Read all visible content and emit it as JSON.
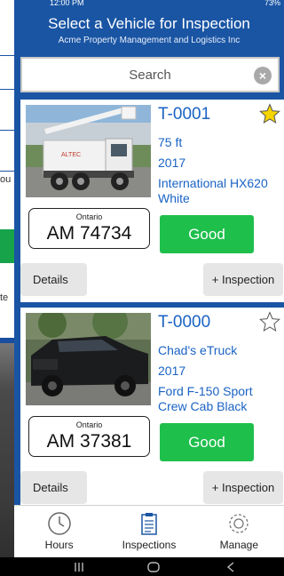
{
  "status_bar": {
    "time": "12:00 PM",
    "battery": "73%"
  },
  "background": {
    "snippet_1": "ou",
    "snippet_2": "te"
  },
  "header": {
    "title": "Select a Vehicle for Inspection",
    "subtitle": "Acme Property Management and Logistics Inc"
  },
  "search": {
    "placeholder": "Search",
    "clear_icon": "clear-icon"
  },
  "vehicles": [
    {
      "unit": "T-0001",
      "line1": "75 ft",
      "year": "2017",
      "model": "International HX620",
      "color": "White",
      "province": "Ontario",
      "plate": "AM 74734",
      "status": "Good",
      "favorite": true,
      "details_label": "Details",
      "inspection_label": "+ Inspection",
      "photo_icon": "bucket-truck-photo"
    },
    {
      "unit": "T-0000",
      "line1": "Chad's eTruck",
      "year": "2017",
      "model": "Ford F-150 Sport",
      "color": "Crew Cab Black",
      "province": "Ontario",
      "plate": "AM 37381",
      "status": "Good",
      "favorite": false,
      "details_label": "Details",
      "inspection_label": "+ Inspection",
      "photo_icon": "pickup-truck-photo"
    }
  ],
  "bottom_nav": [
    {
      "label": "Hours",
      "icon": "clock-icon"
    },
    {
      "label": "Inspections",
      "icon": "clipboard-icon"
    },
    {
      "label": "Manage",
      "icon": "gear-icon"
    }
  ],
  "colors": {
    "header_blue": "#1a55a4",
    "link_blue": "#1a63c4",
    "status_green": "#1fbf4c",
    "star_yellow": "#f5d400"
  }
}
